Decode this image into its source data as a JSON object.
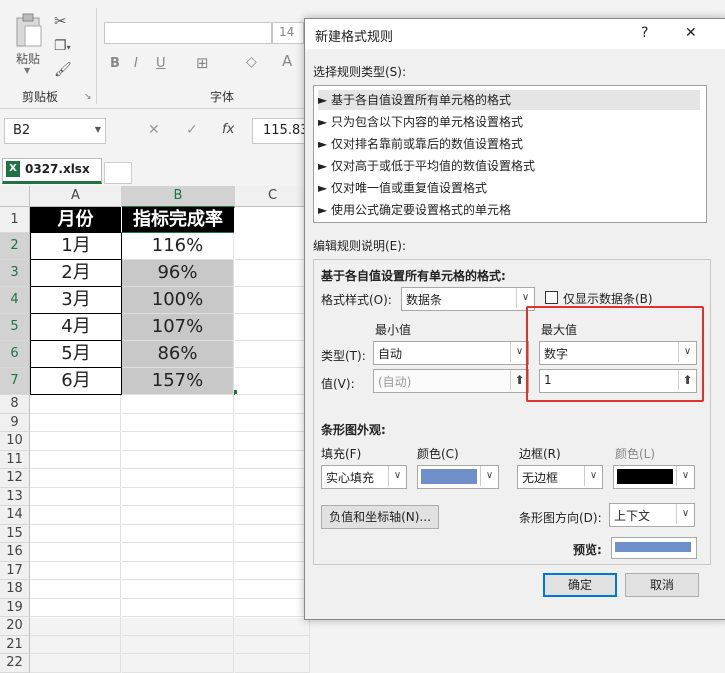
{
  "ribbon": {
    "paste_label": "粘贴",
    "clipboard_group": "剪贴板",
    "font_group": "字体",
    "font_size": "14",
    "bold": "B",
    "italic": "I",
    "underline": "U"
  },
  "formula_bar": {
    "name_box": "B2",
    "fx": "fx",
    "value": "115.833"
  },
  "workbook_tab": "0327.xlsx",
  "sheet": {
    "columns": [
      "A",
      "B",
      "C"
    ],
    "rows": [
      "1",
      "2",
      "3",
      "4",
      "5",
      "6",
      "7",
      "8",
      "9",
      "10",
      "11",
      "12",
      "13",
      "14",
      "15",
      "16",
      "17",
      "18",
      "19",
      "20",
      "21",
      "22"
    ],
    "header": [
      "月份",
      "指标完成率"
    ],
    "data": [
      [
        "1月",
        "116%"
      ],
      [
        "2月",
        "96%"
      ],
      [
        "3月",
        "100%"
      ],
      [
        "4月",
        "107%"
      ],
      [
        "5月",
        "86%"
      ],
      [
        "6月",
        "157%"
      ]
    ]
  },
  "dialog": {
    "title": "新建格式规则",
    "help": "?",
    "close": "✕",
    "select_rule_label": "选择规则类型(S):",
    "rule_types": [
      "► 基于各自值设置所有单元格的格式",
      "► 只为包含以下内容的单元格设置格式",
      "► 仅对排名靠前或靠后的数值设置格式",
      "► 仅对高于或低于平均值的数值设置格式",
      "► 仅对唯一值或重复值设置格式",
      "► 使用公式确定要设置格式的单元格"
    ],
    "edit_rule_label": "编辑规则说明(E):",
    "desc_heading": "基于各自值设置所有单元格的格式:",
    "format_style_label": "格式样式(O):",
    "format_style_value": "数据条",
    "show_bar_only": "仅显示数据条(B)",
    "min_label": "最小值",
    "max_label": "最大值",
    "type_label": "类型(T):",
    "value_label": "值(V):",
    "min_type": "自动",
    "max_type": "数字",
    "min_value": "(自动)",
    "max_value": "1",
    "appearance_label": "条形图外观:",
    "fill_label": "填充(F)",
    "fill_color_label": "颜色(C)",
    "border_label": "边框(R)",
    "border_color_label": "颜色(L)",
    "fill_value": "实心填充",
    "border_value": "无边框",
    "fill_color": "#6f8fc9",
    "border_color": "#000000",
    "negative_button": "负值和坐标轴(N)...",
    "direction_label": "条形图方向(D):",
    "direction_value": "上下文",
    "preview_label": "预览:",
    "ok": "确定",
    "cancel": "取消"
  }
}
